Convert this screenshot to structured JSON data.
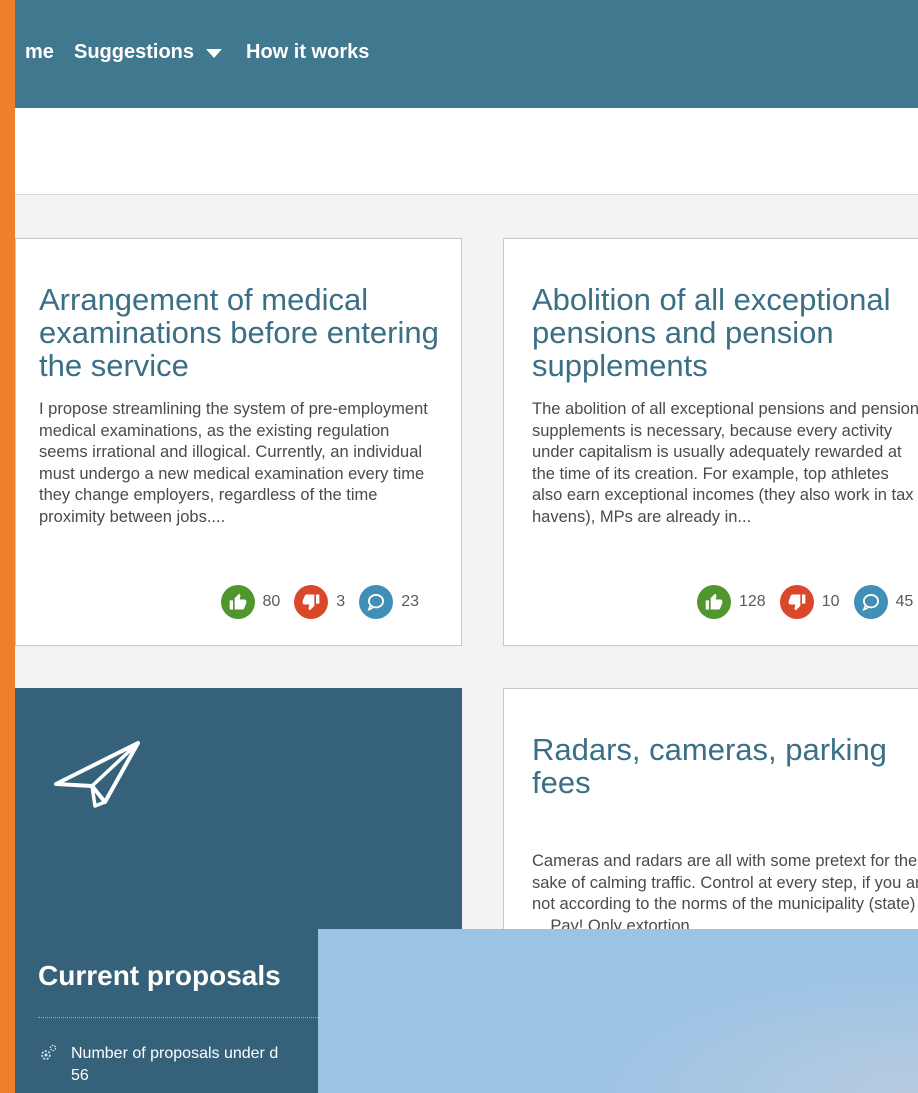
{
  "nav": {
    "home_label": "me",
    "suggestions_label": "Suggestions",
    "how_label": "How it works"
  },
  "cards": [
    {
      "title": "Arrangement of medical examinations before entering the service",
      "text": "I propose streamlining the system of pre-employment medical examinations, as the existing regulation seems irrational and illogical. Currently, an individual must undergo a new medical examination every time they change employers, regardless of the time proximity between jobs....",
      "likes": "80",
      "dislikes": "3",
      "comments": "23"
    },
    {
      "title": "Abolition of all exceptional pensions and pension supplements",
      "text": "The abolition of all exceptional pensions and pension supplements is necessary, because every activity under capitalism is usually adequately rewarded at the time of its creation. For example, top athletes also earn exceptional incomes (they also work in tax havens), MPs are already in...",
      "likes": "128",
      "dislikes": "10",
      "comments": "45"
    },
    {
      "title": "Radars, cameras, parking fees",
      "text": "Cameras and radars are all with some pretext for the sake of calming traffic. Control at every step, if you are not according to the norms of the municipality (state) ... Pay! Only extortion..."
    }
  ],
  "panel": {
    "title": "Current proposals",
    "stat_label": "Number of proposals under d",
    "stat_value": "56"
  },
  "colors": {
    "accent_orange": "#ee7f2d",
    "nav_teal": "#3f788f",
    "panel_teal": "#35627a",
    "title_blue": "#3a6f86",
    "like_green": "#4f962d",
    "dislike_red": "#d9482b",
    "comment_blue": "#3f8fb6"
  },
  "icons": [
    "caret-down-icon",
    "thumbs-up-icon",
    "thumbs-down-icon",
    "comment-icon",
    "paper-plane-icon",
    "gear-icon"
  ]
}
